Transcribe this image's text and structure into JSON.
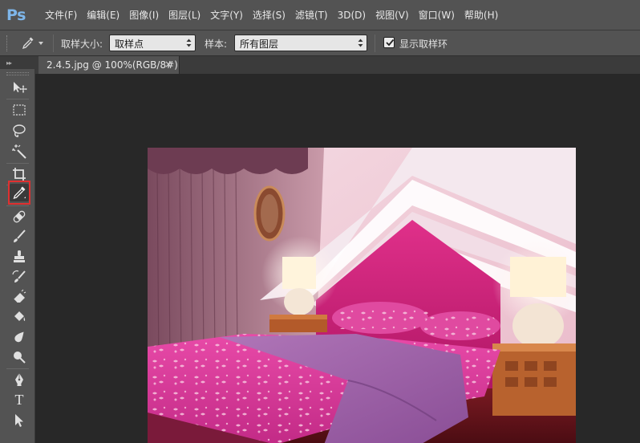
{
  "app": {
    "logo": "Ps",
    "menu": [
      "文件(F)",
      "编辑(E)",
      "图像(I)",
      "图层(L)",
      "文字(Y)",
      "选择(S)",
      "滤镜(T)",
      "3D(D)",
      "视图(V)",
      "窗口(W)",
      "帮助(H)"
    ]
  },
  "options": {
    "sample_size_label": "取样大小:",
    "sample_size_value": "取样点",
    "sample_label": "样本:",
    "sample_value": "所有图层",
    "show_ring_label": "显示取样环",
    "show_ring_checked": true
  },
  "document": {
    "tab_title": "2.4.5.jpg @ 100%(RGB/8#)",
    "close_glyph": "×"
  },
  "tools": [
    {
      "name": "move-tool",
      "icon": "move-icon"
    },
    {
      "name": "marquee-tool",
      "icon": "marquee-icon"
    },
    {
      "name": "lasso-tool",
      "icon": "lasso-icon"
    },
    {
      "name": "magic-wand-tool",
      "icon": "magic-wand-icon"
    },
    {
      "name": "crop-tool",
      "icon": "crop-icon"
    },
    {
      "name": "eyedropper-tool",
      "icon": "eyedropper-icon",
      "active": true
    },
    {
      "name": "healing-brush-tool",
      "icon": "bandage-icon"
    },
    {
      "name": "brush-tool",
      "icon": "brush-icon"
    },
    {
      "name": "clone-stamp-tool",
      "icon": "stamp-icon"
    },
    {
      "name": "history-brush-tool",
      "icon": "history-brush-icon"
    },
    {
      "name": "eraser-tool",
      "icon": "eraser-icon"
    },
    {
      "name": "paint-bucket-tool",
      "icon": "bucket-icon"
    },
    {
      "name": "blur-tool",
      "icon": "droplet-icon"
    },
    {
      "name": "dodge-tool",
      "icon": "dodge-icon"
    },
    {
      "name": "pen-tool",
      "icon": "pen-icon"
    },
    {
      "name": "type-tool",
      "icon": "type-icon",
      "glyph": "T"
    },
    {
      "name": "path-selection-tool",
      "icon": "arrow-icon"
    }
  ],
  "colors": {
    "highlight": "#e03030",
    "logo": "#7eb6ea"
  }
}
